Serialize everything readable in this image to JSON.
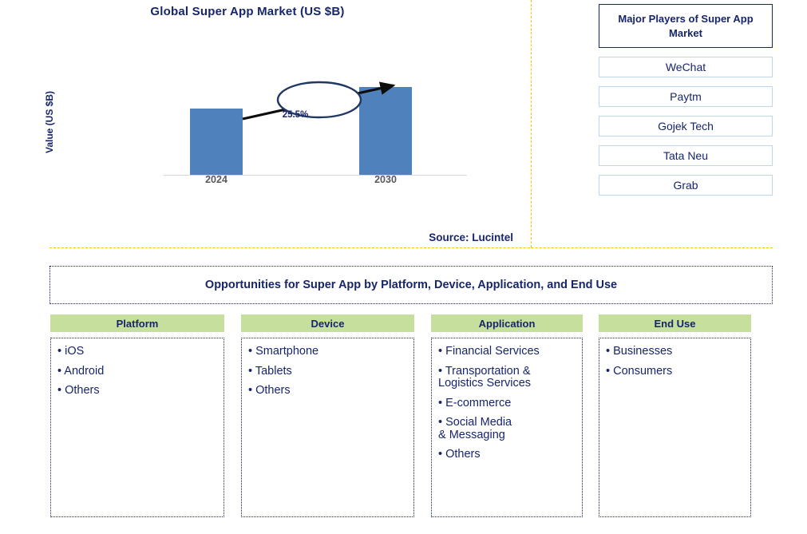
{
  "chart_data": {
    "type": "bar",
    "title": "Global Super App Market (US $B)",
    "xlabel": "",
    "ylabel": "Value (US $B)",
    "categories": [
      "2024",
      "2030"
    ],
    "values": [
      58,
      77
    ],
    "ylim": [
      0,
      90
    ],
    "grid": false,
    "legend": null,
    "annotations": [
      {
        "label": "25.5%",
        "type": "cagr-arrow",
        "from": "2024",
        "to": "2030"
      }
    ],
    "bar_color": "#4F81BD",
    "source": "Source: Lucintel"
  },
  "chart": {
    "title": "Global Super App Market (US $B)",
    "y_axis_label": "Value (US $B)",
    "cagr_label": "25.5%",
    "tick_2024": "2024",
    "tick_2030": "2030",
    "source": "Source: Lucintel"
  },
  "players": {
    "header": "Major Players of Super App Market",
    "items": [
      {
        "name": "WeChat"
      },
      {
        "name": "Paytm"
      },
      {
        "name": "Gojek Tech"
      },
      {
        "name": "Tata Neu"
      },
      {
        "name": "Grab"
      }
    ]
  },
  "opportunities": {
    "banner": "Opportunities for Super App by Platform, Device, Application, and End Use",
    "columns": [
      {
        "header": "Platform",
        "items": [
          "• iOS",
          "• Android",
          "• Others"
        ]
      },
      {
        "header": "Device",
        "items": [
          "• Smartphone",
          "• Tablets",
          "• Others"
        ]
      },
      {
        "header": "Application",
        "items": [
          "• Financial Services",
          "• Transportation &\n   Logistics Services",
          "• E-commerce",
          "• Social Media\n & Messaging",
          "• Others"
        ]
      },
      {
        "header": "End Use",
        "items": [
          "• Businesses",
          "• Consumers"
        ]
      }
    ]
  },
  "colors": {
    "bar": "#4F81BD",
    "navy": "#17256B",
    "green_header": "#C6DF9C",
    "orange_divider": "#FFC000",
    "player_border": "#BDD7EE"
  }
}
